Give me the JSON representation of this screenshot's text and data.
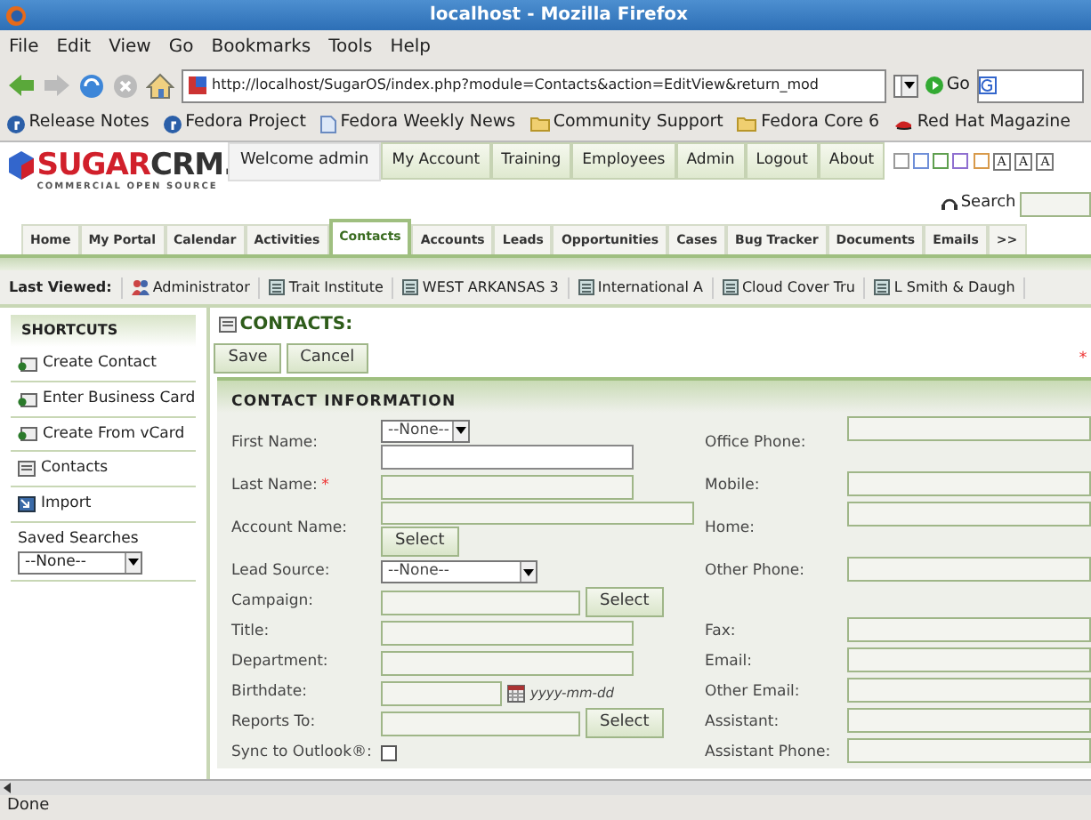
{
  "window": {
    "title": "localhost - Mozilla Firefox"
  },
  "menu": [
    "File",
    "Edit",
    "View",
    "Go",
    "Bookmarks",
    "Tools",
    "Help"
  ],
  "navbar": {
    "url": "http://localhost/SugarOS/index.php?module=Contacts&action=EditView&return_mod",
    "go": "Go"
  },
  "bookmarks": [
    {
      "label": "Release Notes",
      "kind": "fedora"
    },
    {
      "label": "Fedora Project",
      "kind": "fedora"
    },
    {
      "label": "Fedora Weekly News",
      "kind": "page"
    },
    {
      "label": "Community Support",
      "kind": "folder"
    },
    {
      "label": "Fedora Core 6",
      "kind": "folder"
    },
    {
      "label": "Red Hat Magazine",
      "kind": "redhat"
    }
  ],
  "sugar": {
    "logo_a": "SUGAR",
    "logo_b": "CRM.",
    "tagline": "COMMERCIAL OPEN SOURCE",
    "welcome": "Welcome admin",
    "links": [
      "My Account",
      "Training",
      "Employees",
      "Admin",
      "Logout",
      "About"
    ],
    "themes": [
      {
        "color": "#9a9a9a"
      },
      {
        "color": "#6f8fd8"
      },
      {
        "color": "#5f9f4f"
      },
      {
        "color": "#8f6fd0"
      },
      {
        "color": "#d89a4a"
      }
    ],
    "font_sizes": [
      "A",
      "A",
      "A"
    ],
    "search": "Search"
  },
  "tabs": [
    {
      "label": "Home",
      "selected": false
    },
    {
      "label": "My Portal",
      "selected": false
    },
    {
      "label": "Calendar",
      "selected": false
    },
    {
      "label": "Activities",
      "selected": false
    },
    {
      "label": "Contacts",
      "selected": true
    },
    {
      "label": "Accounts",
      "selected": false
    },
    {
      "label": "Leads",
      "selected": false
    },
    {
      "label": "Opportunities",
      "selected": false
    },
    {
      "label": "Cases",
      "selected": false
    },
    {
      "label": "Bug Tracker",
      "selected": false
    },
    {
      "label": "Documents",
      "selected": false
    },
    {
      "label": "Emails",
      "selected": false
    },
    {
      "label": ">>",
      "selected": false
    }
  ],
  "last_viewed": {
    "label": "Last Viewed:",
    "items": [
      {
        "label": "Administrator",
        "kind": "user"
      },
      {
        "label": "Trait Institute",
        "kind": "account"
      },
      {
        "label": "WEST ARKANSAS 3",
        "kind": "account"
      },
      {
        "label": "International A",
        "kind": "account"
      },
      {
        "label": "Cloud Cover Tru",
        "kind": "account"
      },
      {
        "label": "L Smith & Daugh",
        "kind": "account"
      }
    ]
  },
  "sidebar": {
    "title": "SHORTCUTS",
    "items": [
      {
        "label": "Create Contact",
        "kind": "create"
      },
      {
        "label": "Enter Business Card",
        "kind": "create"
      },
      {
        "label": "Create From vCard",
        "kind": "create"
      },
      {
        "label": "Contacts",
        "kind": "list"
      },
      {
        "label": "Import",
        "kind": "import"
      }
    ],
    "saved_searches": "Saved Searches",
    "saved_value": "--None--"
  },
  "main": {
    "title": "CONTACTS:",
    "buttons": [
      "Save",
      "Cancel"
    ],
    "required_note": "*",
    "section": "CONTACT INFORMATION",
    "rows": [
      {
        "left": {
          "label": "First Name:",
          "kind": "name",
          "salutation": "--None--",
          "required": false
        },
        "right": {
          "label": "Office Phone:"
        }
      },
      {
        "left": {
          "label": "Last Name:",
          "kind": "text",
          "required": true
        },
        "right": {
          "label": "Mobile:"
        }
      },
      {
        "left": {
          "label": "Account Name:",
          "kind": "relate_below",
          "button": "Select",
          "required": false
        },
        "right": {
          "label": "Home:"
        }
      },
      {
        "left": {
          "label": "Lead Source:",
          "kind": "select",
          "value": "--None--",
          "required": false
        },
        "right": {
          "label": "Other Phone:"
        }
      },
      {
        "left": {
          "label": "Campaign:",
          "kind": "relate",
          "button": "Select",
          "required": false
        },
        "right": null
      },
      {
        "left": {
          "label": "Title:",
          "kind": "text",
          "required": false
        },
        "right": {
          "label": "Fax:"
        }
      },
      {
        "left": {
          "label": "Department:",
          "kind": "text",
          "required": false
        },
        "right": {
          "label": "Email:"
        }
      },
      {
        "left": {
          "label": "Birthdate:",
          "kind": "date",
          "hint": "yyyy-mm-dd",
          "required": false
        },
        "right": {
          "label": "Other Email:"
        }
      },
      {
        "left": {
          "label": "Reports To:",
          "kind": "relate",
          "button": "Select",
          "required": false
        },
        "right": {
          "label": "Assistant:"
        }
      },
      {
        "left": {
          "label": "Sync to Outlook®:",
          "kind": "checkbox",
          "checked": false,
          "required": false
        },
        "right": {
          "label": "Assistant Phone:"
        }
      }
    ]
  },
  "status_bar": "Done"
}
